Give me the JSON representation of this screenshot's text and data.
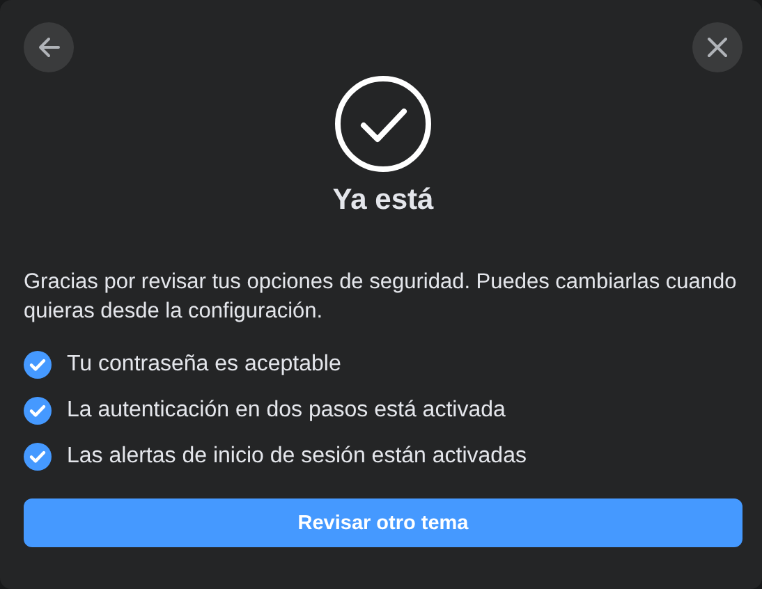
{
  "dialog": {
    "title": "Ya está",
    "message": "Gracias por revisar tus opciones de seguridad. Puedes cambiarlas cuando quieras desde la configuración.",
    "items": [
      {
        "text": "Tu contraseña es aceptable",
        "checked": true
      },
      {
        "text": "La autenticación en dos pasos está activada",
        "checked": true
      },
      {
        "text": "Las alertas de inicio de sesión están activadas",
        "checked": true
      }
    ],
    "primary_button": "Revisar otro tema"
  }
}
